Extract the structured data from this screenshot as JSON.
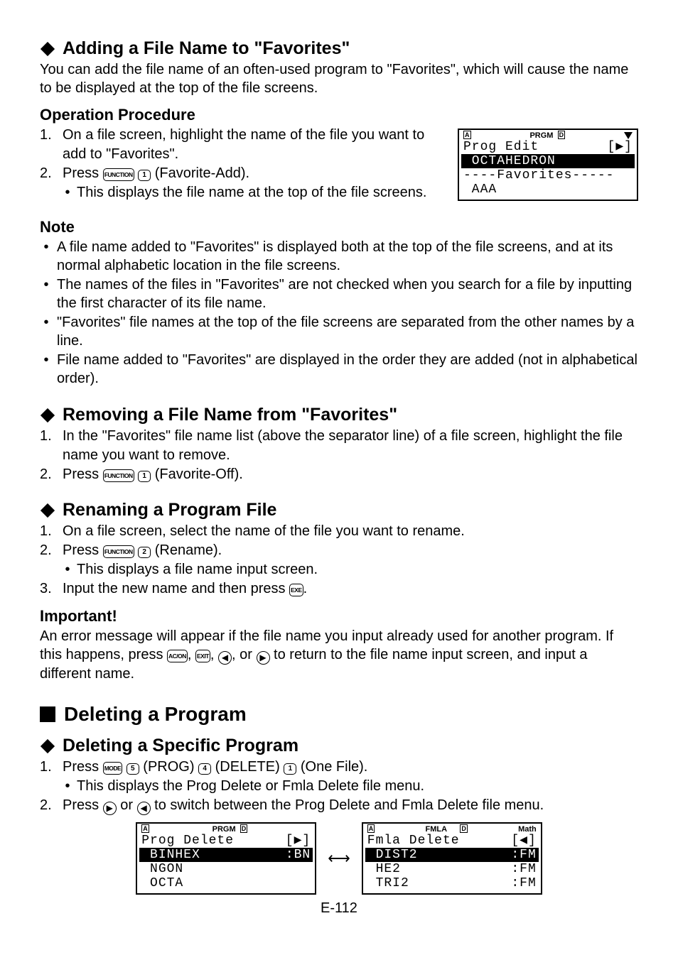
{
  "sec1": {
    "title": "Adding a File Name to \"Favorites\"",
    "intro": "You can add the file name of an often-used program to \"Favorites\", which will cause the name to be displayed at the top of the file screens.",
    "op_heading": "Operation Procedure",
    "step1": "On a file screen, highlight the name of the file you want to add to \"Favorites\".",
    "step2_pre": "Press ",
    "step2_key1": "FUNCTION",
    "step2_key2": "1",
    "step2_post": " (Favorite-Add).",
    "step2_sub": "This displays the file name at the top of the file screens.",
    "note_heading": "Note",
    "note1": "A file name added to \"Favorites\" is displayed both at the top of the file screens, and at its normal alphabetic location in the file screens.",
    "note2": "The names of the files in \"Favorites\" are not checked when you search for a file by inputting the first character of its file name.",
    "note3": "\"Favorites\" file names at the top of the file screens are separated from the other names by a line.",
    "note4": "File name added to \"Favorites\" are displayed in the order they are added (not in alphabetical order)."
  },
  "lcd1": {
    "status_mode": "PRGM",
    "line1_left": "Prog Edit",
    "line1_right": "[▶]",
    "line2": " OCTAHEDRON",
    "line3": "----Favorites-----",
    "line4": " AAA"
  },
  "sec2": {
    "title": "Removing a File Name from \"Favorites\"",
    "step1": "In the \"Favorites\" file name list (above the separator line) of a file screen, highlight the file name you want to remove.",
    "step2_pre": "Press ",
    "step2_key1": "FUNCTION",
    "step2_key2": "1",
    "step2_post": " (Favorite-Off)."
  },
  "sec3": {
    "title": "Renaming a Program File",
    "step1": "On a file screen, select the name of the file you want to rename.",
    "step2_pre": "Press ",
    "step2_key1": "FUNCTION",
    "step2_key2": "2",
    "step2_post": " (Rename).",
    "step2_sub": "This displays a file name input screen.",
    "step3_pre": "Input the new name and then press ",
    "step3_key": "EXE",
    "step3_post": ".",
    "important_heading": "Important!",
    "important_pre": "An error message will appear if the file name you input already used for another program. If this happens, press ",
    "k_ac": "AC/ON",
    "k_exit": "EXIT",
    "important_mid1": ", ",
    "important_mid2": ", ",
    "important_mid3": ", or ",
    "important_post": " to return to the file name input screen, and input a different name."
  },
  "sec4": {
    "title_big": "Deleting a Program",
    "title_sub": "Deleting a Specific Program",
    "step1_pre": "Press ",
    "k_mode": "MODE",
    "k5": "5",
    "prog": " (PROG)",
    "k4": "4",
    "delete": " (DELETE)",
    "k1": "1",
    "one": " (One File).",
    "step1_sub": "This displays the Prog Delete or Fmla Delete file menu.",
    "step2_pre": "Press ",
    "step2_mid": " or ",
    "step2_post": " to switch between the Prog Delete and Fmla Delete file menu."
  },
  "lcd2": {
    "status_mode": "PRGM",
    "l1_left": "Prog Delete",
    "l1_right": "[▶]",
    "l2_left": " BINHEX",
    "l2_right": ":BN",
    "l3": " NGON",
    "l4": " OCTA"
  },
  "lcd3": {
    "status_mode": "FMLA",
    "status_extra": "Math",
    "l1_left": "Fmla Delete",
    "l1_right": "[◀]",
    "l2_left": " DIST2",
    "l2_right": ":FM",
    "l3_left": " HE2",
    "l3_right": ":FM",
    "l4_left": " TRI2",
    "l4_right": ":FM"
  },
  "arrow_symbol": "⟷",
  "page_number": "E-112",
  "indicators": {
    "a": "A",
    "d": "D"
  }
}
